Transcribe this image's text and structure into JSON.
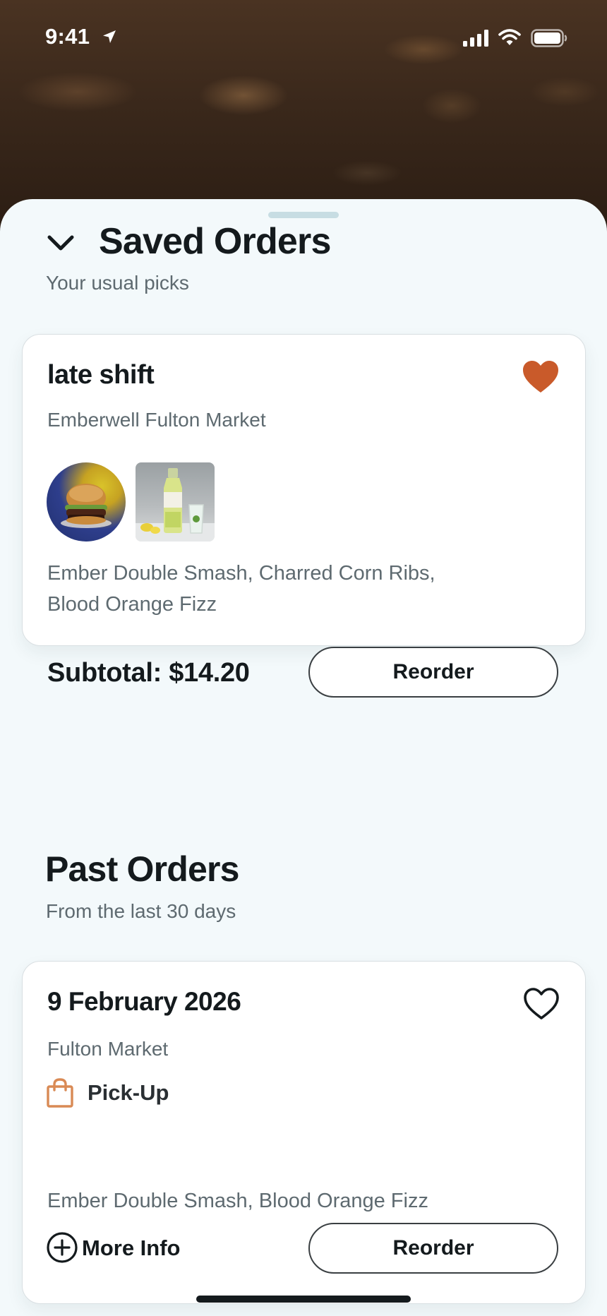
{
  "status_bar": {
    "time": "9:41"
  },
  "saved_orders": {
    "title": "Saved Orders",
    "subtitle": "Your usual picks",
    "card": {
      "name": "late shift",
      "location": "Emberwell Fulton Market",
      "favorited": true,
      "items": "Ember Double Smash, Charred Corn Ribs, Blood Orange Fizz",
      "subtotal": "Subtotal: $14.20",
      "reorder_label": "Reorder"
    }
  },
  "past_orders": {
    "title": "Past Orders",
    "subtitle": "From the last 30 days",
    "card": {
      "date": "9 February 2026",
      "location": "Fulton Market",
      "favorited": false,
      "fulfillment": "Pick-Up",
      "items": "Ember Double Smash, Blood Orange Fizz",
      "more_info_label": "More Info",
      "reorder_label": "Reorder"
    }
  },
  "icons": {
    "collapse": "chevron-down-icon",
    "favorite_filled": "heart-filled-icon",
    "favorite_outline": "heart-outline-icon",
    "pickup": "shopping-bag-icon",
    "more_info": "plus-circle-icon"
  },
  "colors": {
    "accent": "#c95a2a",
    "pickup_icon": "#d98a55",
    "sheet_background": "#f3f9fb",
    "text_primary": "#141a1d",
    "text_secondary": "#5e6a70"
  }
}
